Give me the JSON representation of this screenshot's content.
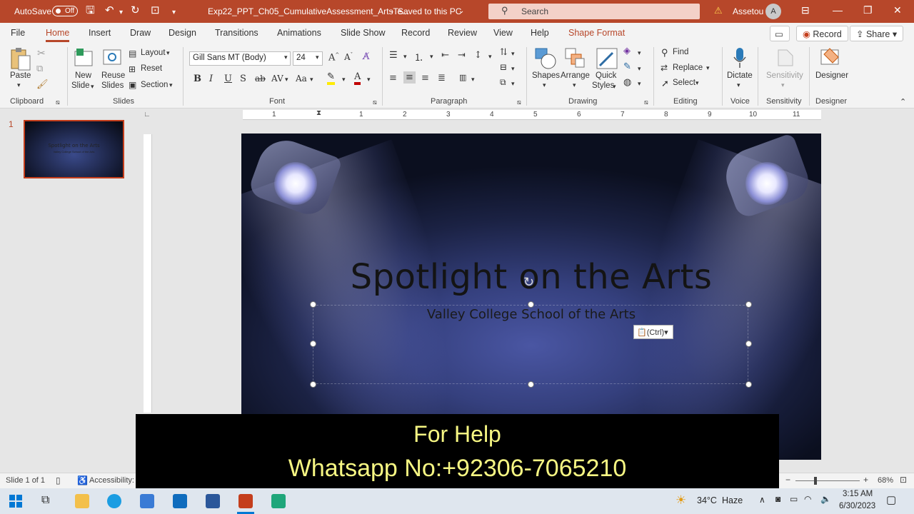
{
  "titlebar": {
    "autosave_label": "AutoSave",
    "autosave_state": "Off",
    "filename": "Exp22_PPT_Ch05_CumulativeAssessment_ArtsTe...",
    "save_status": "Saved to this PC",
    "search_placeholder": "Search",
    "user_name": "Assetou",
    "avatar_initial": "A"
  },
  "tabs": [
    "File",
    "Home",
    "Insert",
    "Draw",
    "Design",
    "Transitions",
    "Animations",
    "Slide Show",
    "Record",
    "Review",
    "View",
    "Help",
    "Shape Format"
  ],
  "tab_actions": {
    "record": "Record",
    "share": "Share"
  },
  "ribbon": {
    "clipboard": {
      "paste": "Paste",
      "group": "Clipboard"
    },
    "slides": {
      "new_slide_1": "New",
      "new_slide_2": "Slide",
      "reuse_1": "Reuse",
      "reuse_2": "Slides",
      "layout": "Layout",
      "reset": "Reset",
      "section": "Section",
      "group": "Slides"
    },
    "font": {
      "family": "Gill Sans MT (Body)",
      "size": "24",
      "group": "Font"
    },
    "paragraph": {
      "group": "Paragraph"
    },
    "drawing": {
      "shapes": "Shapes",
      "arrange": "Arrange",
      "quick_1": "Quick",
      "quick_2": "Styles",
      "group": "Drawing"
    },
    "editing": {
      "find": "Find",
      "replace": "Replace",
      "select": "Select",
      "group": "Editing"
    },
    "voice": {
      "dictate": "Dictate",
      "group": "Voice"
    },
    "sensitivity": {
      "label": "Sensitivity",
      "group": "Sensitivity"
    },
    "designer": {
      "label": "Designer",
      "group": "Designer"
    }
  },
  "ruler": {
    "labels": [
      "1",
      "0",
      "1",
      "2",
      "3",
      "4",
      "5",
      "6",
      "7",
      "8",
      "9",
      "10",
      "11"
    ]
  },
  "thumbnails": [
    {
      "number": "1",
      "title": "Spotlight on the Arts",
      "subtitle": "Valley College School of the Arts"
    }
  ],
  "slide": {
    "title": "Spotlight on the Arts",
    "subtitle": "Valley College School of the Arts"
  },
  "paste_options": "(Ctrl)",
  "overlay": {
    "line1": "For Help",
    "line2": "Whatsapp No:+92306-7065210"
  },
  "status": {
    "slide_info": "Slide 1 of 1",
    "accessibility": "Accessibility:",
    "zoom": "68%"
  },
  "taskbar": {
    "weather_temp": "34°C",
    "weather_desc": "Haze",
    "time": "3:15 AM",
    "date": "6/30/2023"
  },
  "colors": {
    "accent": "#b7472a",
    "overlay_text": "#f7f783",
    "overlay_bg": "#000000"
  }
}
